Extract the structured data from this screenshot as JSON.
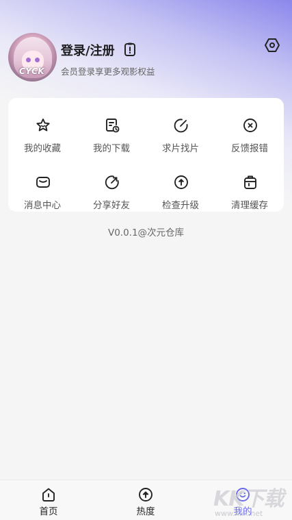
{
  "profile": {
    "title": "登录/注册",
    "subtitle": "会员登录享更多观影权益",
    "avatar_caption": "CYCK"
  },
  "menu": {
    "row1": [
      {
        "label": "我的收藏",
        "icon": "star-icon"
      },
      {
        "label": "我的下载",
        "icon": "download-clock-icon"
      },
      {
        "label": "求片找片",
        "icon": "edit-icon"
      },
      {
        "label": "反馈报错",
        "icon": "close-circle-icon"
      }
    ],
    "row2": [
      {
        "label": "消息中心",
        "icon": "mail-icon"
      },
      {
        "label": "分享好友",
        "icon": "share-icon"
      },
      {
        "label": "检查升级",
        "icon": "upgrade-icon"
      },
      {
        "label": "清理缓存",
        "icon": "trash-icon"
      }
    ]
  },
  "version_text": "V0.0.1@次元仓库",
  "tabs": [
    {
      "label": "首页",
      "icon": "home-icon"
    },
    {
      "label": "热度",
      "icon": "hot-icon"
    },
    {
      "label": "我的",
      "icon": "profile-icon",
      "active": true
    }
  ],
  "watermark": {
    "big": "KK下载",
    "small": "www.kkx.net"
  },
  "colors": {
    "accent": "#6c6be8",
    "card_bg": "#ffffff",
    "page_bg": "#f5f5f6"
  }
}
